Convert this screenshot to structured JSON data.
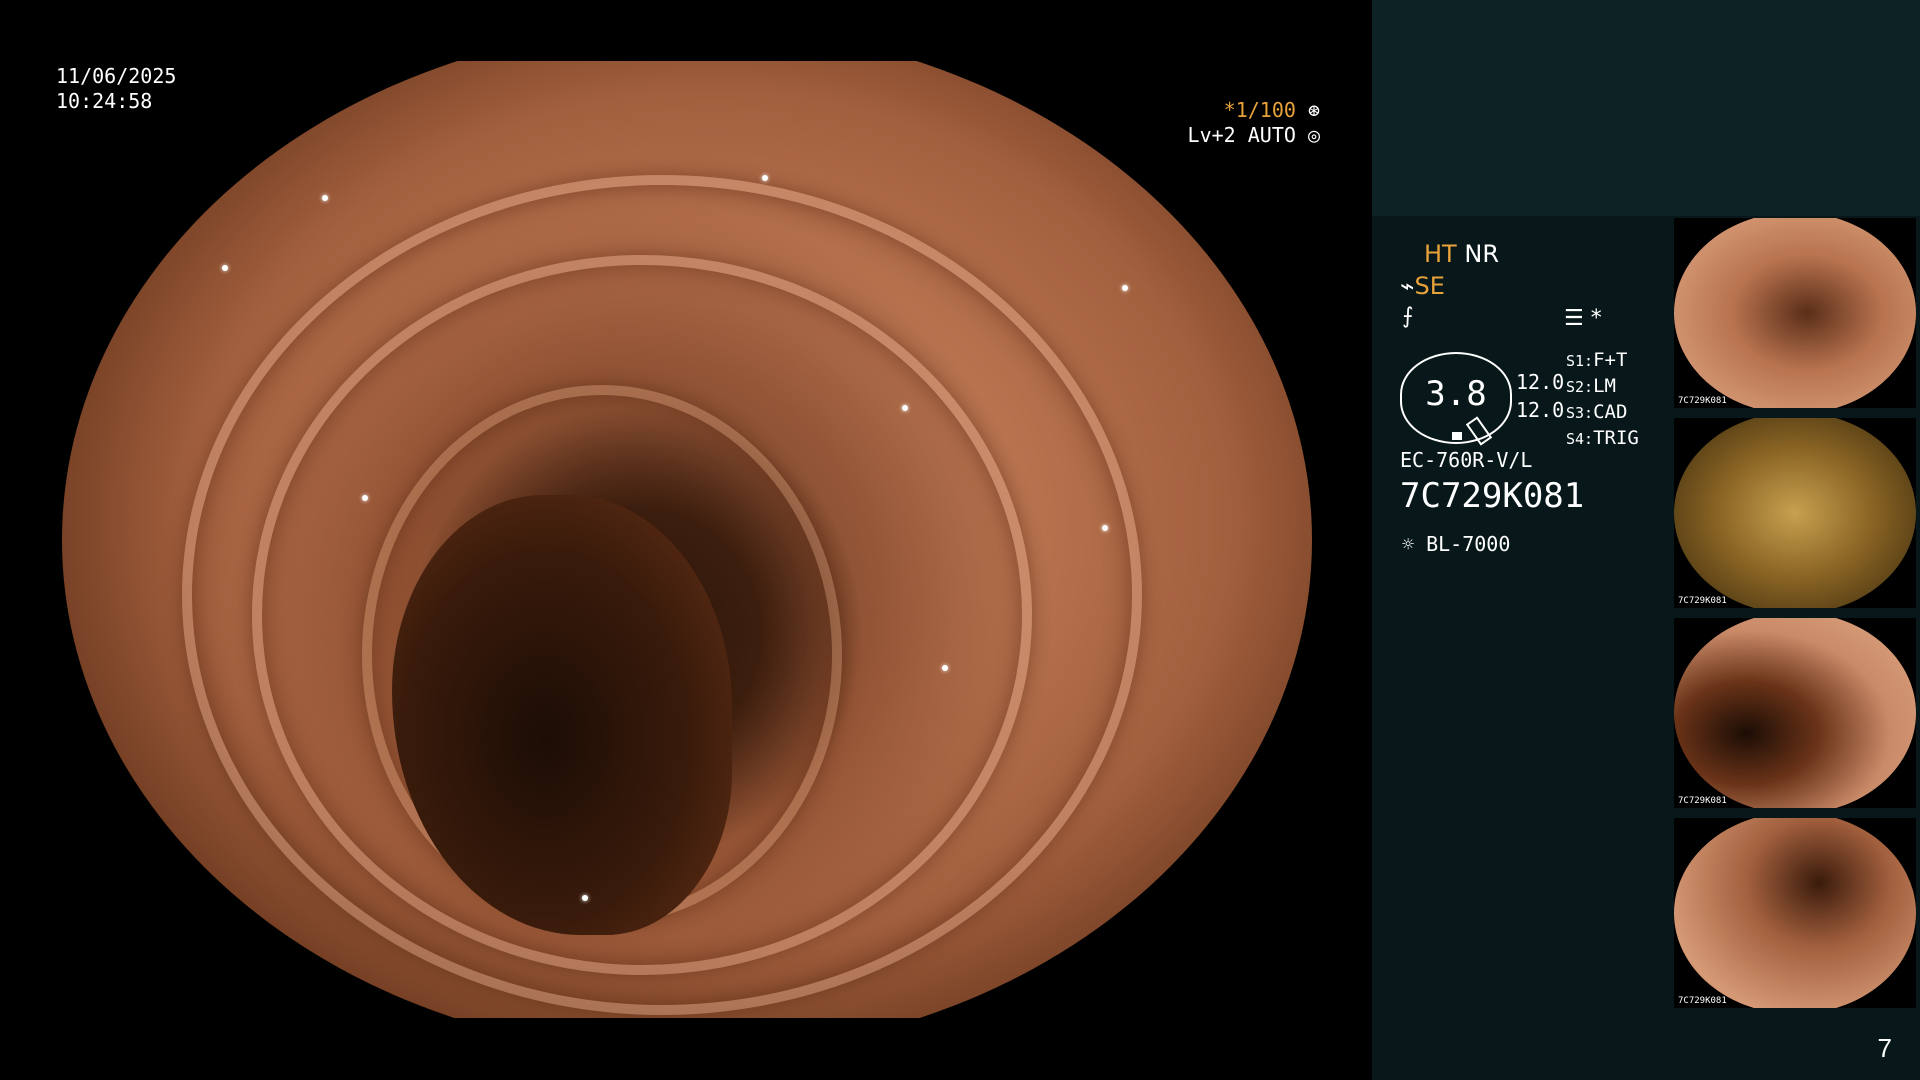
{
  "overlay": {
    "date": "11/06/2025",
    "time": "10:24:58",
    "shutter": "*1/100",
    "level": "Lv+2 AUTO"
  },
  "panel": {
    "ht": "HT",
    "nr": "NR",
    "se": "SE",
    "gauge_value": "3.8",
    "value_a": "12.0",
    "value_b": "12.0",
    "switches": [
      {
        "key": "S1:",
        "value": "F+T"
      },
      {
        "key": "S2:",
        "value": "LM"
      },
      {
        "key": "S3:",
        "value": "CAD"
      },
      {
        "key": "S4:",
        "value": "TRIG"
      }
    ],
    "scope_model": "EC-760R-V/L",
    "serial": "7C729K081",
    "light_source": "BL-7000",
    "star": "*"
  },
  "thumbnails": [
    {
      "caption": "7C729K081"
    },
    {
      "caption": "7C729K081"
    },
    {
      "caption": "7C729K081"
    },
    {
      "caption": "7C729K081"
    }
  ],
  "page_number": "7",
  "colors": {
    "accent": "#e8a23a",
    "panel_top": "#0c2224",
    "panel_body": "#08181a"
  }
}
